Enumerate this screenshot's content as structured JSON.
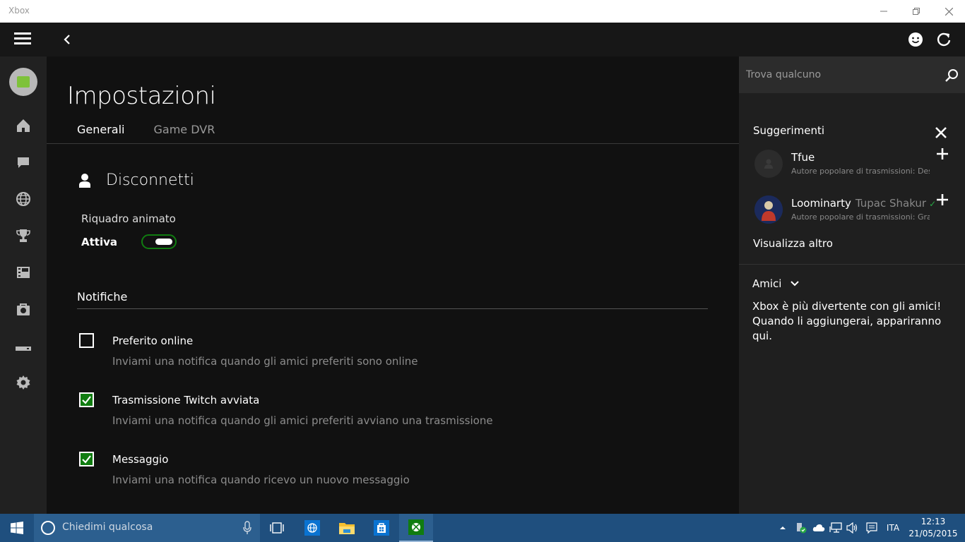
{
  "window": {
    "title": "Xbox"
  },
  "page": {
    "title": "Impostazioni",
    "tabs": [
      {
        "label": "Generali",
        "active": true
      },
      {
        "label": "Game DVR",
        "active": false
      }
    ]
  },
  "account": {
    "disconnect_label": "Disconnetti"
  },
  "live_tile": {
    "label": "Riquadro animato",
    "state_label": "Attiva",
    "on": true
  },
  "notifications": {
    "title": "Notifiche",
    "items": [
      {
        "title": "Preferito online",
        "description": "Inviami una notifica quando gli amici preferiti sono online",
        "checked": false
      },
      {
        "title": "Trasmissione Twitch avviata",
        "description": "Inviami una notifica quando gli amici preferiti avviano una trasmissione",
        "checked": true
      },
      {
        "title": "Messaggio",
        "description": "Inviami una notifica quando ricevo un nuovo messaggio",
        "checked": true
      }
    ]
  },
  "right_panel": {
    "search_placeholder": "Trova qualcuno",
    "suggestions_title": "Suggerimenti",
    "suggestions": [
      {
        "name": "Tfue",
        "real_name": "",
        "description": "Autore popolare di trasmissioni: Dest"
      },
      {
        "name": "Loominarty",
        "real_name": "Tupac Shakur",
        "description": "Autore popolare di trasmissioni: Gran"
      }
    ],
    "see_more": "Visualizza altro",
    "friends_label": "Amici",
    "friends_message": "Xbox è più divertente con gli amici! Quando li aggiungerai, appariranno qui."
  },
  "taskbar": {
    "search_placeholder": "Chiedimi qualcosa",
    "language": "ITA",
    "time": "12:13",
    "date": "21/05/2015"
  },
  "colors": {
    "accent": "#107c10",
    "taskbar": "#1f4f7e"
  }
}
